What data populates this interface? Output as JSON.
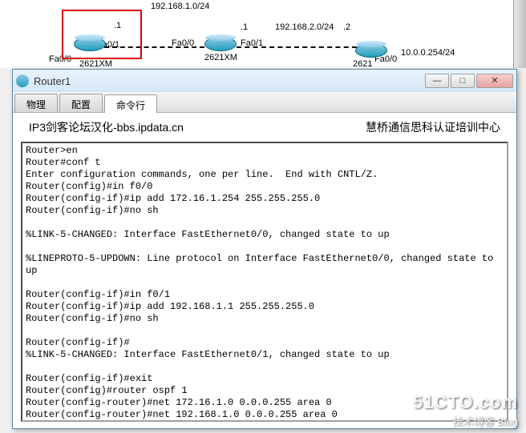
{
  "topology": {
    "net1": "192.168.1.0/24",
    "net2": "192.168.2.0/24",
    "net3": "10.0.0.254/24",
    "host1": ".1",
    "host2": ".1",
    "host3": ".2",
    "if_fa00": "Fa0/0",
    "if_fa01": "Fa0/1",
    "model": "2621XM"
  },
  "window": {
    "title": "Router1",
    "tabs": [
      "物理",
      "配置",
      "命令行"
    ],
    "banner_left": "IP3剑客论坛汉化-bbs.ipdata.cn",
    "banner_right": "慧桥通信思科认证培训中心"
  },
  "cli": "Router>en\nRouter#conf t\nEnter configuration commands, one per line.  End with CNTL/Z.\nRouter(config)#in f0/0\nRouter(config-if)#ip add 172.16.1.254 255.255.255.0\nRouter(config-if)#no sh\n\n%LINK-5-CHANGED: Interface FastEthernet0/0, changed state to up\n\n%LINEPROTO-5-UPDOWN: Line protocol on Interface FastEthernet0/0, changed state to up\n\nRouter(config-if)#in f0/1\nRouter(config-if)#ip add 192.168.1.1 255.255.255.0\nRouter(config-if)#no sh\n\nRouter(config-if)#\n%LINK-5-CHANGED: Interface FastEthernet0/1, changed state to up\n\nRouter(config-if)#exit\nRouter(config)#router ospf 1\nRouter(config-router)#net 172.16.1.0 0.0.0.255 area 0\nRouter(config-router)#net 192.168.1.0 0.0.0.255 area 0\nRouter(config-router)#",
  "watermark": {
    "big": "51CTO.com",
    "small": "技术博客   Blog"
  }
}
